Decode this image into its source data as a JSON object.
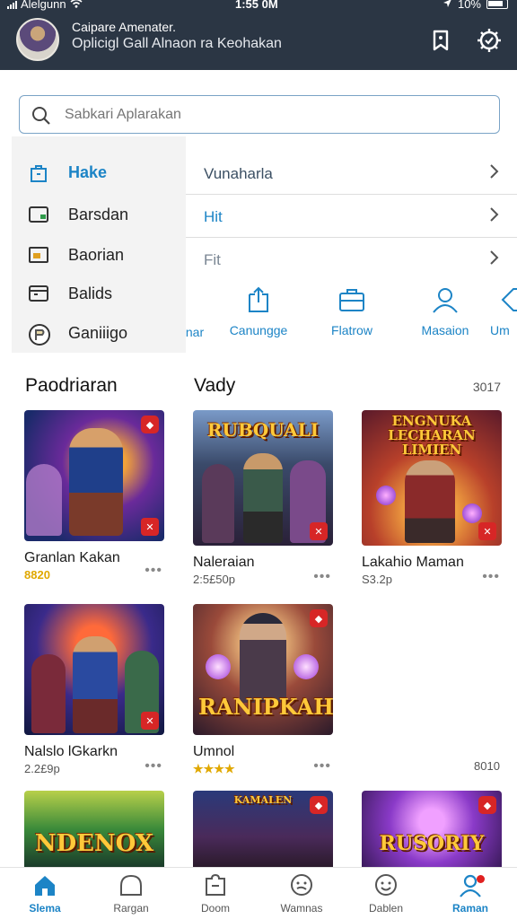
{
  "status_bar": {
    "carrier": "Alelgunn",
    "time": "1:55 0M",
    "battery": "10%"
  },
  "header": {
    "title": "Caipare Amenater.",
    "subtitle": "Oplicigl Gall Alnaon ra Keohakan"
  },
  "search": {
    "placeholder": "Sabkari Aplarakan"
  },
  "left_menu": [
    {
      "label": "Hake",
      "icon": "bag-icon",
      "active": true
    },
    {
      "label": "Barsdan",
      "icon": "card-icon"
    },
    {
      "label": "Baorian",
      "icon": "wallet-icon"
    },
    {
      "label": "Balids",
      "icon": "folder-icon"
    },
    {
      "label": "Ganiiigo",
      "icon": "controller-icon"
    }
  ],
  "right_list": [
    {
      "label": "Vunaharla"
    },
    {
      "label": "Hit"
    },
    {
      "label": "Fit"
    }
  ],
  "quick_categories": [
    {
      "label": "nar",
      "icon": "partial-icon"
    },
    {
      "label": "Canungge",
      "icon": "upload-icon"
    },
    {
      "label": "Flatrow",
      "icon": "briefcase-icon"
    },
    {
      "label": "Masaion",
      "icon": "user-icon"
    },
    {
      "label": "Um",
      "icon": "tag-icon"
    }
  ],
  "sections": {
    "left_title": "Paodriaran",
    "right_title": "Vady",
    "right_extra": "3017"
  },
  "games": [
    {
      "name": "Granlan Kakan",
      "sub": "8820",
      "sub_gold": true,
      "art": ""
    },
    {
      "name": "Naleraian",
      "sub": "2:5£50p",
      "art": "RUBQUALI"
    },
    {
      "name": "Lakahio Maman",
      "sub": "S3.2p",
      "art": "ENGNUKA LECHARAN LIMIEN"
    },
    {
      "name": "Nalslo lGkarkn",
      "sub": "2.2£9p",
      "art": ""
    },
    {
      "name": "Umnol",
      "sub": "★★★★",
      "sub_gold": true,
      "art": "RANIPKAH"
    },
    {
      "name": "",
      "sub": "8010",
      "art": ""
    },
    {
      "name": "",
      "sub": "",
      "art": "NDENOX"
    },
    {
      "name": "",
      "sub": "",
      "art": "KAMALEN"
    },
    {
      "name": "",
      "sub": "",
      "art": "RUSORIY"
    }
  ],
  "bottom_nav": [
    {
      "label": "Slema",
      "icon": "home-icon",
      "active": true
    },
    {
      "label": "Rargan",
      "icon": "dome-icon"
    },
    {
      "label": "Doom",
      "icon": "puzzle-icon"
    },
    {
      "label": "Wamnas",
      "icon": "chat-icon"
    },
    {
      "label": "Dablen",
      "icon": "smile-icon"
    },
    {
      "label": "Raman",
      "icon": "profile-icon",
      "badge": true
    }
  ]
}
